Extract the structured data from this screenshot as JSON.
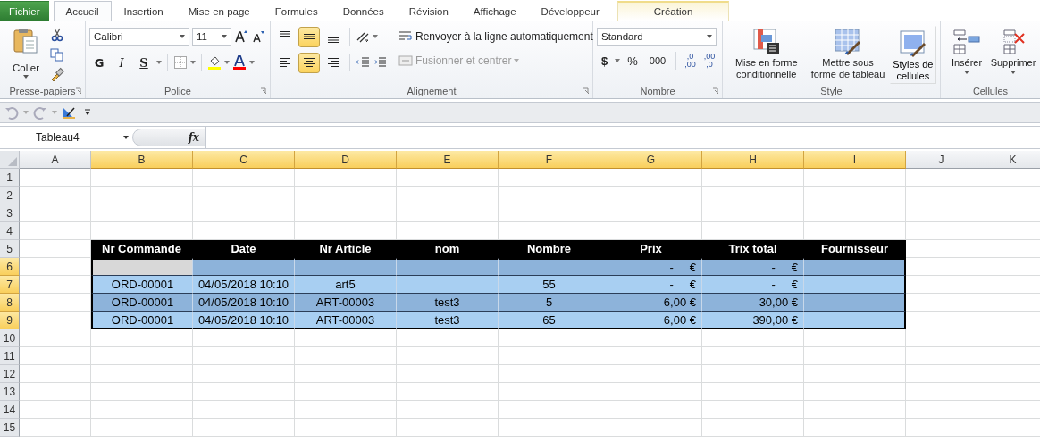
{
  "tabs": [
    {
      "label": "Fichier",
      "kind": "file",
      "selected": false
    },
    {
      "label": "Accueil",
      "kind": "normal",
      "selected": true
    },
    {
      "label": "Insertion",
      "kind": "normal",
      "selected": false
    },
    {
      "label": "Mise en page",
      "kind": "normal",
      "selected": false
    },
    {
      "label": "Formules",
      "kind": "normal",
      "selected": false
    },
    {
      "label": "Données",
      "kind": "normal",
      "selected": false
    },
    {
      "label": "Révision",
      "kind": "normal",
      "selected": false
    },
    {
      "label": "Affichage",
      "kind": "normal",
      "selected": false
    },
    {
      "label": "Développeur",
      "kind": "normal",
      "selected": false
    },
    {
      "label": "Création",
      "kind": "contextual",
      "selected": false
    }
  ],
  "ribbon": {
    "clipboard": {
      "label": "Presse-papiers",
      "paste": "Coller"
    },
    "font": {
      "label": "Police",
      "family": "Calibri",
      "size": "11",
      "bold": "G",
      "italic": "I",
      "underline": "S"
    },
    "alignment": {
      "label": "Alignement",
      "vertical": [
        {
          "selected": false
        },
        {
          "selected": true
        },
        {
          "selected": false
        }
      ],
      "horizontal": [
        {
          "selected": false
        },
        {
          "selected": true
        },
        {
          "selected": false
        }
      ],
      "wrap": "Renvoyer à la ligne automatiquement",
      "merge": "Fusionner et centrer",
      "merge_disabled": true
    },
    "number": {
      "label": "Nombre",
      "format": "Standard",
      "currency": "$",
      "percent": "%",
      "thousands": "000",
      "decimals": [
        {
          "top": ",0",
          "bottom": ",00"
        },
        {
          "top": ",00",
          "bottom": ",0"
        }
      ]
    },
    "style": {
      "label": "Style",
      "buttons": [
        {
          "kind": "conditional",
          "label": "Mise en forme conditionnelle"
        },
        {
          "kind": "table",
          "label": "Mettre sous forme de tableau"
        },
        {
          "kind": "cell",
          "label": "Styles de cellules"
        }
      ]
    },
    "cells": {
      "label": "Cellules",
      "buttons": [
        {
          "kind": "insert",
          "label": "Insérer"
        },
        {
          "kind": "delete",
          "label": "Supprimer"
        }
      ]
    }
  },
  "formula_bar": {
    "name_box": "Tableau4",
    "fx": "fx"
  },
  "sheet": {
    "columns": [
      {
        "letter": "A",
        "selected": false
      },
      {
        "letter": "B",
        "selected": true
      },
      {
        "letter": "C",
        "selected": true
      },
      {
        "letter": "D",
        "selected": true
      },
      {
        "letter": "E",
        "selected": true
      },
      {
        "letter": "F",
        "selected": true
      },
      {
        "letter": "G",
        "selected": true
      },
      {
        "letter": "H",
        "selected": true
      },
      {
        "letter": "I",
        "selected": true
      },
      {
        "letter": "J",
        "selected": false
      },
      {
        "letter": "K",
        "selected": false
      }
    ],
    "rows": [
      {
        "number": "1",
        "selected": false
      },
      {
        "number": "2",
        "selected": false
      },
      {
        "number": "3",
        "selected": false
      },
      {
        "number": "4",
        "selected": false
      },
      {
        "number": "5",
        "selected": false
      },
      {
        "number": "6",
        "selected": true
      },
      {
        "number": "7",
        "selected": true
      },
      {
        "number": "8",
        "selected": true
      },
      {
        "number": "9",
        "selected": true
      },
      {
        "number": "10",
        "selected": false
      },
      {
        "number": "11",
        "selected": false
      },
      {
        "number": "12",
        "selected": false
      },
      {
        "number": "13",
        "selected": false
      },
      {
        "number": "14",
        "selected": false
      },
      {
        "number": "15",
        "selected": false
      }
    ],
    "table": {
      "header": [
        "Nr Commande",
        "Date",
        "Nr Article",
        "nom",
        "Nombre",
        "Prix",
        "Trix total",
        "Fournisseur"
      ],
      "rows": [
        {
          "kind": "dark",
          "cells": [
            {
              "active": true
            },
            {
              "active": false
            },
            {
              "active": false
            },
            {
              "active": false
            },
            {
              "active": false
            },
            {
              "text": "-     €",
              "active": false
            },
            {
              "text": "-     €",
              "active": false
            },
            {
              "active": false
            }
          ]
        },
        {
          "kind": "light",
          "cells": [
            {
              "text": "ORD-00001",
              "active": false
            },
            {
              "text": "04/05/2018 10:10",
              "active": false
            },
            {
              "text": "art5",
              "active": false
            },
            {
              "active": false
            },
            {
              "text": "55",
              "active": false
            },
            {
              "text": "-     €",
              "active": false
            },
            {
              "text": "-     €",
              "active": false
            },
            {
              "active": false
            }
          ]
        },
        {
          "kind": "dark",
          "cells": [
            {
              "text": "ORD-00001",
              "active": false
            },
            {
              "text": "04/05/2018 10:10",
              "active": false
            },
            {
              "text": "ART-00003",
              "active": false
            },
            {
              "text": "test3",
              "active": false
            },
            {
              "text": "5",
              "active": false
            },
            {
              "text": "6,00 €",
              "active": false
            },
            {
              "text": "30,00 €",
              "active": false
            },
            {
              "active": false
            }
          ]
        },
        {
          "kind": "light",
          "cells": [
            {
              "text": "ORD-00001",
              "active": false
            },
            {
              "text": "04/05/2018 10:10",
              "active": false
            },
            {
              "text": "ART-00003",
              "active": false
            },
            {
              "text": "test3",
              "active": false
            },
            {
              "text": "65",
              "active": false
            },
            {
              "text": "6,00 €",
              "active": false
            },
            {
              "text": "390,00 €",
              "active": false
            },
            {
              "active": false
            }
          ]
        }
      ]
    }
  }
}
